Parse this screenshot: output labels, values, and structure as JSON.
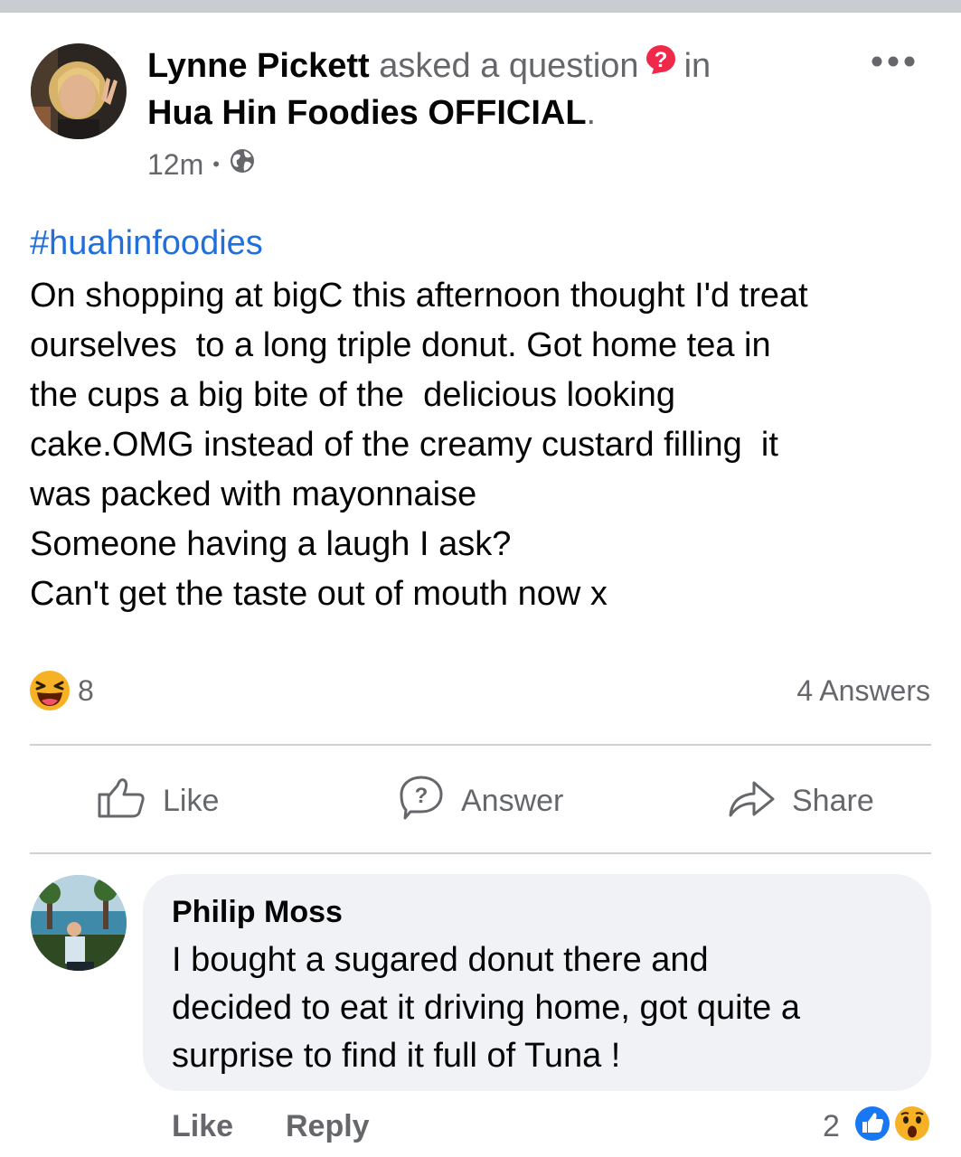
{
  "post": {
    "author": "Lynne Pickett",
    "action_text": "asked a question",
    "in_text": "in",
    "group": "Hua Hin Foodies OFFICIAL",
    "group_period": ".",
    "time": "12m",
    "meta_dot": "•",
    "hashtag": "#huahinfoodies",
    "body_lines": [
      "On shopping at bigC this afternoon thought I'd treat",
      "ourselves  to a long triple donut. Got home tea in",
      "the cups a big bite of the  delicious looking",
      "cake.OMG instead of the creamy custard filling  it",
      "was packed with mayonnaise",
      "Someone having a laugh I ask?",
      "Can't get the taste out of mouth now x"
    ],
    "reactions": {
      "icon": "haha-emoji-icon",
      "count": "8"
    },
    "answers_count": "4 Answers"
  },
  "actions": {
    "like": "Like",
    "answer": "Answer",
    "share": "Share"
  },
  "comment": {
    "author": "Philip Moss",
    "text_lines": [
      "I bought a sugared donut there and",
      "decided to eat it driving home, got quite a",
      "surprise to find it full of Tuna !"
    ],
    "like": "Like",
    "reply": "Reply",
    "reaction_count": "2",
    "reaction_icons": [
      "like-reaction-icon",
      "wow-reaction-icon"
    ]
  },
  "colors": {
    "link_blue": "#216fdb",
    "muted": "#65676b",
    "bubble": "#f0f2f5",
    "question_badge": "#f02849",
    "divider": "#ced0d4"
  }
}
